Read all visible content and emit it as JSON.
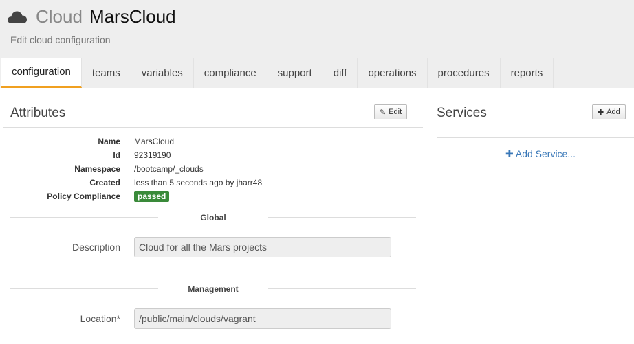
{
  "header": {
    "icon": "cloud-icon",
    "type_label": "Cloud",
    "name": "MarsCloud",
    "subtitle": "Edit cloud configuration"
  },
  "tabs": [
    {
      "label": "configuration",
      "active": true
    },
    {
      "label": "teams"
    },
    {
      "label": "variables"
    },
    {
      "label": "compliance"
    },
    {
      "label": "support"
    },
    {
      "label": "diff"
    },
    {
      "label": "operations"
    },
    {
      "label": "procedures"
    },
    {
      "label": "reports"
    }
  ],
  "attributes": {
    "title": "Attributes",
    "edit_label": "Edit",
    "rows": [
      {
        "label": "Name",
        "value": "MarsCloud"
      },
      {
        "label": "Id",
        "value": "92319190"
      },
      {
        "label": "Namespace",
        "value": "/bootcamp/_clouds"
      },
      {
        "label": "Created",
        "value": "less than 5 seconds ago by jharr48"
      },
      {
        "label": "Policy Compliance",
        "value": "passed"
      }
    ]
  },
  "global": {
    "heading": "Global",
    "description_label": "Description",
    "description_value": "Cloud for all the Mars projects"
  },
  "management": {
    "heading": "Management",
    "location_label": "Location*",
    "location_value": "/public/main/clouds/vagrant"
  },
  "services": {
    "title": "Services",
    "add_label": "Add",
    "add_service_label": "Add Service..."
  },
  "colors": {
    "header_bg": "#eeeeee",
    "active_tab_underline": "#f0a020",
    "passed_badge": "#3a8a3a",
    "link": "#3a78b8"
  }
}
